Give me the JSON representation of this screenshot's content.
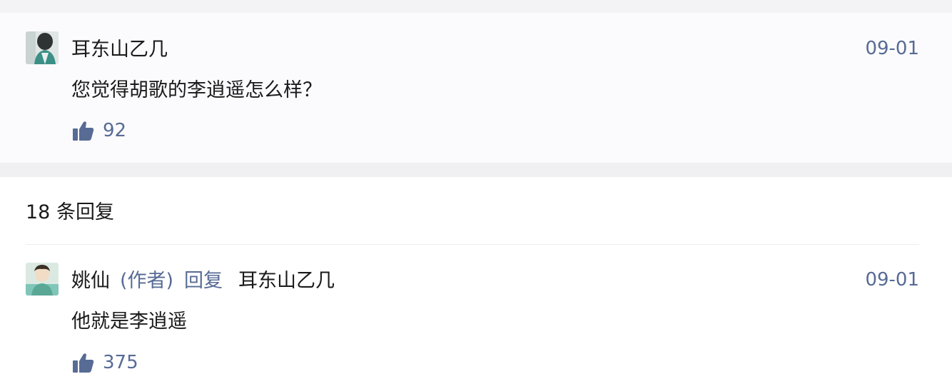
{
  "comment": {
    "username": "耳东山乙几",
    "date": "09-01",
    "text": "您觉得胡歌的李逍遥怎么样？",
    "likes": "92",
    "avatar_icon": "avatar-user-icon"
  },
  "replies": {
    "count_label": "18 条回复",
    "items": [
      {
        "username": "姚仙",
        "author_tag": "(作者)",
        "reply_word": "回复",
        "reply_to": "耳东山乙几",
        "date": "09-01",
        "text": "他就是李逍遥",
        "likes": "375",
        "avatar_icon": "avatar-author-icon"
      }
    ]
  },
  "colors": {
    "link_blue": "#576b95",
    "text": "#1a1a1a",
    "card_bg": "#fbfbfd",
    "gap_bg": "#f0f0f3"
  }
}
